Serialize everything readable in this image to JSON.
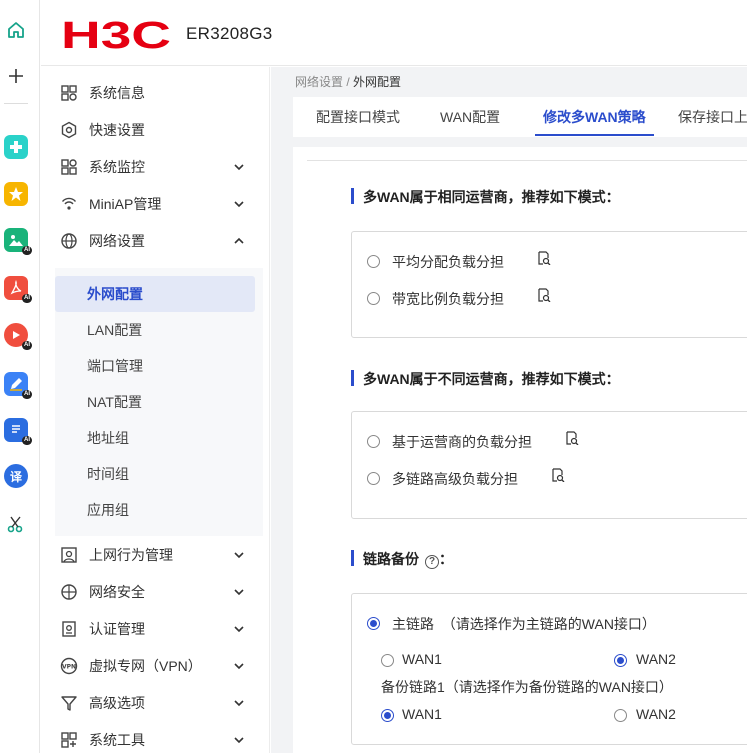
{
  "header": {
    "brand": "H3C",
    "model": "ER3208G3",
    "brand_color": "#e50012"
  },
  "sidebar": {
    "items": [
      {
        "label": "系统信息",
        "icon": "system-info-icon"
      },
      {
        "label": "快速设置",
        "icon": "quick-setup-icon"
      },
      {
        "label": "系统监控",
        "icon": "system-monitor-icon"
      },
      {
        "label": "MiniAP管理",
        "icon": "miniap-icon"
      },
      {
        "label": "网络设置",
        "icon": "globe-icon"
      },
      {
        "label": "上网行为管理",
        "icon": "behavior-icon"
      },
      {
        "label": "网络安全",
        "icon": "security-globe-icon"
      },
      {
        "label": "认证管理",
        "icon": "auth-icon"
      },
      {
        "label": "虚拟专网（VPN）",
        "icon": "vpn-icon"
      },
      {
        "label": "高级选项",
        "icon": "advanced-icon"
      },
      {
        "label": "系统工具",
        "icon": "tools-icon"
      }
    ],
    "submenu": [
      "外网配置",
      "LAN配置",
      "端口管理",
      "NAT配置",
      "地址组",
      "时间组",
      "应用组"
    ]
  },
  "breadcrumb": {
    "parent": "网络设置 / ",
    "current": "外网配置"
  },
  "tabs": [
    "配置接口模式",
    "WAN配置",
    "修改多WAN策略",
    "保存接口上"
  ],
  "sections": {
    "same_isp_title": "多WAN属于相同运营商，推荐如下模式：",
    "same_isp_opts": [
      "平均分配负载分担",
      "带宽比例负载分担"
    ],
    "diff_isp_title": "多WAN属于不同运营商，推荐如下模式：",
    "diff_isp_opts": [
      "基于运营商的负载分担",
      "多链路高级负载分担"
    ],
    "backup_title": "链路备份",
    "backup_suffix": "：",
    "main_link_label": "主链路",
    "main_link_hint": "（请选择作为主链路的WAN接口）",
    "backup_link_label": "备份链路1（请选择作为备份链路的WAN接口）",
    "wan1": "WAN1",
    "wan2": "WAN2"
  },
  "colors": {
    "accent": "#2b4dcc"
  }
}
